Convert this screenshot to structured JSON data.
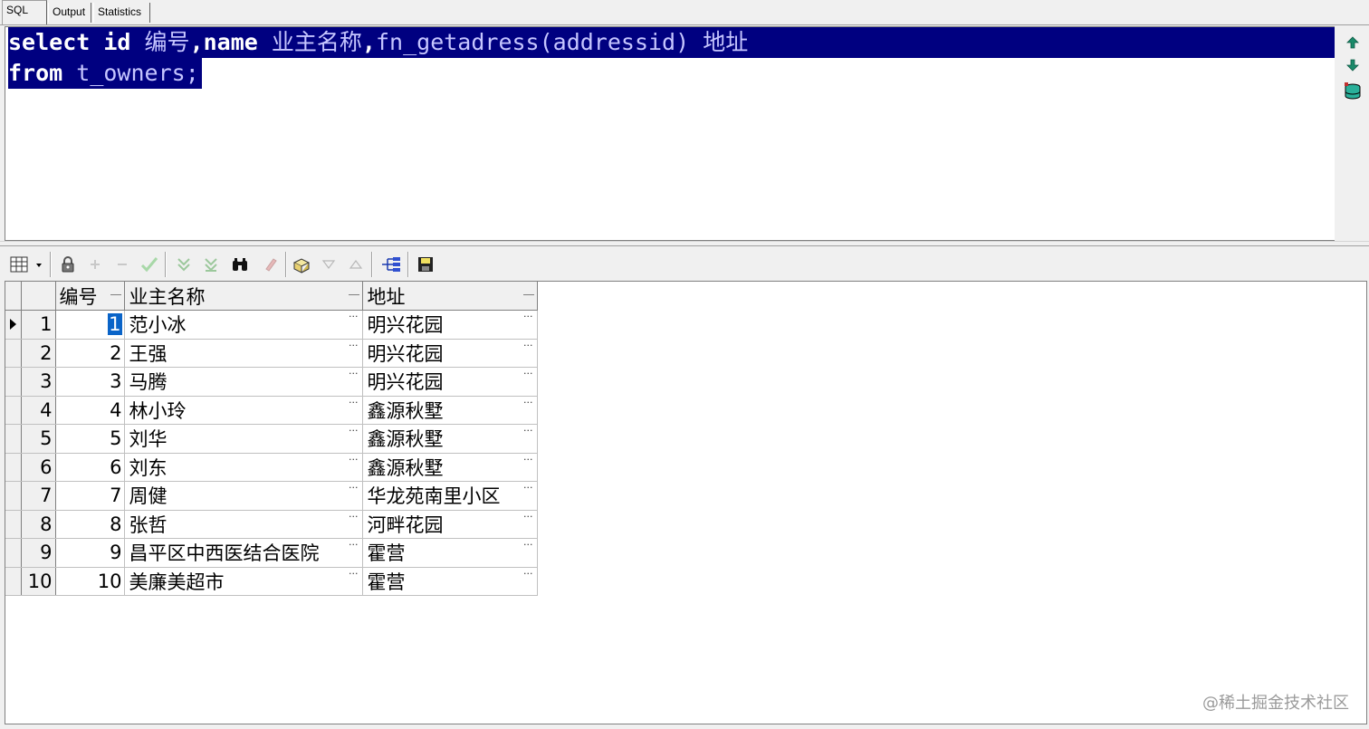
{
  "tabs": [
    {
      "label": "SQL",
      "active": true
    },
    {
      "label": "Output",
      "active": false
    },
    {
      "label": "Statistics",
      "active": false
    }
  ],
  "editor": {
    "line1": {
      "kw_select": "select",
      "kw_id": "id",
      "alias_id": "编号",
      "sep1": ",",
      "kw_name": "name",
      "alias_name": "业主名称",
      "sep2": ",",
      "fn": "fn_getadress(addressid)",
      "alias_addr": "地址"
    },
    "line2": {
      "kw_from": "from",
      "table": "t_owners;"
    }
  },
  "side_icons": [
    "arrow-up-icon",
    "arrow-down-icon",
    "database-icon"
  ],
  "toolbar_icons": [
    "grid-icon",
    "lock-icon",
    "plus-icon",
    "minus-icon",
    "check-icon",
    "filter-down-icon",
    "filter-up-icon",
    "binoculars-icon",
    "eraser-icon",
    "export-icon",
    "sort-down-icon",
    "sort-up-icon",
    "query-tree-icon",
    "save-icon"
  ],
  "grid": {
    "columns": [
      "编号",
      "业主名称",
      "地址"
    ],
    "rows": [
      {
        "n": "1",
        "id": "1",
        "name": "范小冰",
        "addr": "明兴花园"
      },
      {
        "n": "2",
        "id": "2",
        "name": "王强",
        "addr": "明兴花园"
      },
      {
        "n": "3",
        "id": "3",
        "name": "马腾",
        "addr": "明兴花园"
      },
      {
        "n": "4",
        "id": "4",
        "name": "林小玲",
        "addr": "鑫源秋墅"
      },
      {
        "n": "5",
        "id": "5",
        "name": "刘华",
        "addr": "鑫源秋墅"
      },
      {
        "n": "6",
        "id": "6",
        "name": "刘东",
        "addr": "鑫源秋墅"
      },
      {
        "n": "7",
        "id": "7",
        "name": "周健",
        "addr": "华龙苑南里小区"
      },
      {
        "n": "8",
        "id": "8",
        "name": "张哲",
        "addr": "河畔花园"
      },
      {
        "n": "9",
        "id": "9",
        "name": "昌平区中西医结合医院",
        "addr": "霍营"
      },
      {
        "n": "10",
        "id": "10",
        "name": "美廉美超市",
        "addr": "霍营"
      }
    ],
    "cell_dots": "···"
  },
  "watermark": "@稀土掘金技术社区",
  "colors": {
    "selection": "#000080",
    "active_cell": "#0a64c8"
  }
}
